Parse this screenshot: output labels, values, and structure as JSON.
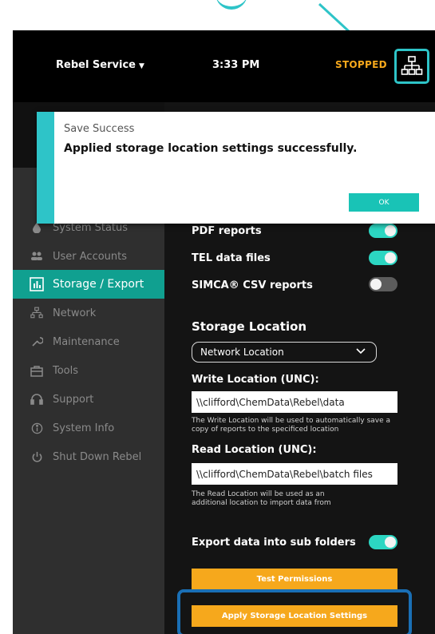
{
  "topbar": {
    "user_menu": "Rebel Service",
    "time": "3:33 PM",
    "status": "STOPPED",
    "network_icon": "network-icon"
  },
  "sidebar": {
    "items": [
      {
        "label": "System Status",
        "icon": "water-drop-icon"
      },
      {
        "label": "User Accounts",
        "icon": "users-icon"
      },
      {
        "label": "Storage / Export",
        "icon": "bar-chart-icon",
        "active": true
      },
      {
        "label": "Network",
        "icon": "network-icon"
      },
      {
        "label": "Maintenance",
        "icon": "wrench-icon"
      },
      {
        "label": "Tools",
        "icon": "toolbox-icon"
      },
      {
        "label": "Support",
        "icon": "headset-icon"
      },
      {
        "label": "System Info",
        "icon": "info-icon"
      },
      {
        "label": "Shut Down Rebel",
        "icon": "power-icon"
      }
    ]
  },
  "content": {
    "toggles": [
      {
        "label": "PDF reports",
        "on": true
      },
      {
        "label": "TEL data files",
        "on": true
      },
      {
        "label": "SIMCA® CSV reports",
        "on": false
      }
    ],
    "storage_location": {
      "heading": "Storage Location",
      "selected": "Network Location"
    },
    "write_location": {
      "label": "Write Location (UNC):",
      "value": "\\\\clifford\\ChemData\\Rebel\\data",
      "help": "The Write Location will be used to automatically save a copy of reports to the specificed location"
    },
    "read_location": {
      "label": "Read Location (UNC):",
      "value": "\\\\clifford\\ChemData\\Rebel\\batch files",
      "help": "The Read Location will be used as an additional location to import data from"
    },
    "subfolders": {
      "label": "Export data into sub folders",
      "on": true
    },
    "test_button": "Test Permissions",
    "apply_button": "Apply Storage Location Settings"
  },
  "dialog": {
    "title": "Save Success",
    "message": "Applied storage location settings successfully.",
    "ok": "OK"
  },
  "colors": {
    "accent_teal": "#2ec4c8",
    "active_nav": "#10a090",
    "status_orange": "#f6a81c",
    "focus_blue": "#1a6fb5"
  }
}
